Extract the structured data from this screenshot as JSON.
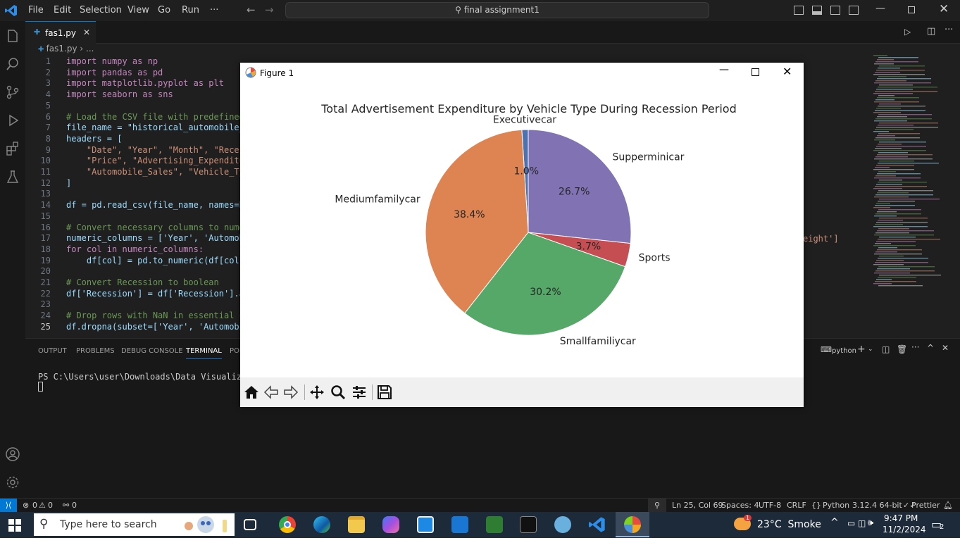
{
  "titlebar": {
    "menus": [
      "File",
      "Edit",
      "Selection",
      "View",
      "Go",
      "Run",
      "···"
    ],
    "search": "final assignment1"
  },
  "tabs": [
    {
      "label": "fas1.py"
    }
  ],
  "breadcrumb": {
    "file": "fas1.py",
    "rest": "..."
  },
  "code_lines": [
    {
      "n": "1",
      "t": "import numpy as np"
    },
    {
      "n": "2",
      "t": "import pandas as pd"
    },
    {
      "n": "3",
      "t": "import matplotlib.pyplot as plt"
    },
    {
      "n": "4",
      "t": "import seaborn as sns"
    },
    {
      "n": "5",
      "t": ""
    },
    {
      "n": "6",
      "t": "# Load the CSV file with predefined hea"
    },
    {
      "n": "7",
      "t": "file_name = \"historical_automobile_sale"
    },
    {
      "n": "8",
      "t": "headers = ["
    },
    {
      "n": "9",
      "t": "    \"Date\", \"Year\", \"Month\", \"Recession"
    },
    {
      "n": "10",
      "t": "    \"Price\", \"Advertising_Expenditure\","
    },
    {
      "n": "11",
      "t": "    \"Automobile_Sales\", \"Vehicle_Type\","
    },
    {
      "n": "12",
      "t": "]"
    },
    {
      "n": "13",
      "t": ""
    },
    {
      "n": "14",
      "t": "df = pd.read_csv(file_name, names=heade"
    },
    {
      "n": "15",
      "t": ""
    },
    {
      "n": "16",
      "t": "# Convert necessary columns to numeric"
    },
    {
      "n": "17",
      "t": "numeric_columns = ['Year', 'Automobile_"
    },
    {
      "n": "18",
      "t": "for col in numeric_columns:"
    },
    {
      "n": "19",
      "t": "    df[col] = pd.to_numeric(df[col], er"
    },
    {
      "n": "20",
      "t": ""
    },
    {
      "n": "21",
      "t": "# Convert Recession to boolean"
    },
    {
      "n": "22",
      "t": "df['Recession'] = df['Recession'].astyp"
    },
    {
      "n": "23",
      "t": ""
    },
    {
      "n": "24",
      "t": "# Drop rows with NaN in essential colum"
    },
    {
      "n": "25",
      "t": "df.dropna(subset=['Year', 'Automobile_S"
    }
  ],
  "code_overflow_text": "eight']",
  "panel": {
    "tabs": [
      "OUTPUT",
      "PROBLEMS",
      "DEBUG CONSOLE",
      "TERMINAL",
      "POR"
    ],
    "active_tab": "TERMINAL",
    "terminal_label": "python",
    "terminal_line": "PS C:\\Users\\user\\Downloads\\Data Visualization\\Da"
  },
  "statusbar": {
    "errors": "0",
    "warnings": "0",
    "ports": "0",
    "position": "Ln 25, Col 69",
    "spaces": "Spaces: 4",
    "encoding": "UTF-8",
    "eol": "CRLF",
    "language": "Python",
    "interpreter": "3.12.4 64-bit",
    "formatter": "Prettier"
  },
  "taskbar": {
    "search_placeholder": "Type here to search",
    "weather": "23°C  Smoke",
    "time": "9:47 PM",
    "date": "11/2/2024",
    "notifications": "2",
    "weather_badge": "1"
  },
  "figure": {
    "window_title": "Figure 1"
  },
  "chart_data": {
    "type": "pie",
    "title": "Total Advertisement Expenditure by Vehicle Type During Recession Period",
    "slices": [
      {
        "label": "Executivecar",
        "value": 1.0,
        "pct": "1.0%",
        "color": "#4c72b0"
      },
      {
        "label": "Mediumfamilycar",
        "value": 38.4,
        "pct": "38.4%",
        "color": "#dd8452"
      },
      {
        "label": "Smallfamiliycar",
        "value": 30.2,
        "pct": "30.2%",
        "color": "#55a868"
      },
      {
        "label": "Sports",
        "value": 3.7,
        "pct": "3.7%",
        "color": "#c44e52"
      },
      {
        "label": "Supperminicar",
        "value": 26.7,
        "pct": "26.7%",
        "color": "#8172b3"
      }
    ],
    "start_angle_deg": 90,
    "direction": "counterclockwise"
  }
}
